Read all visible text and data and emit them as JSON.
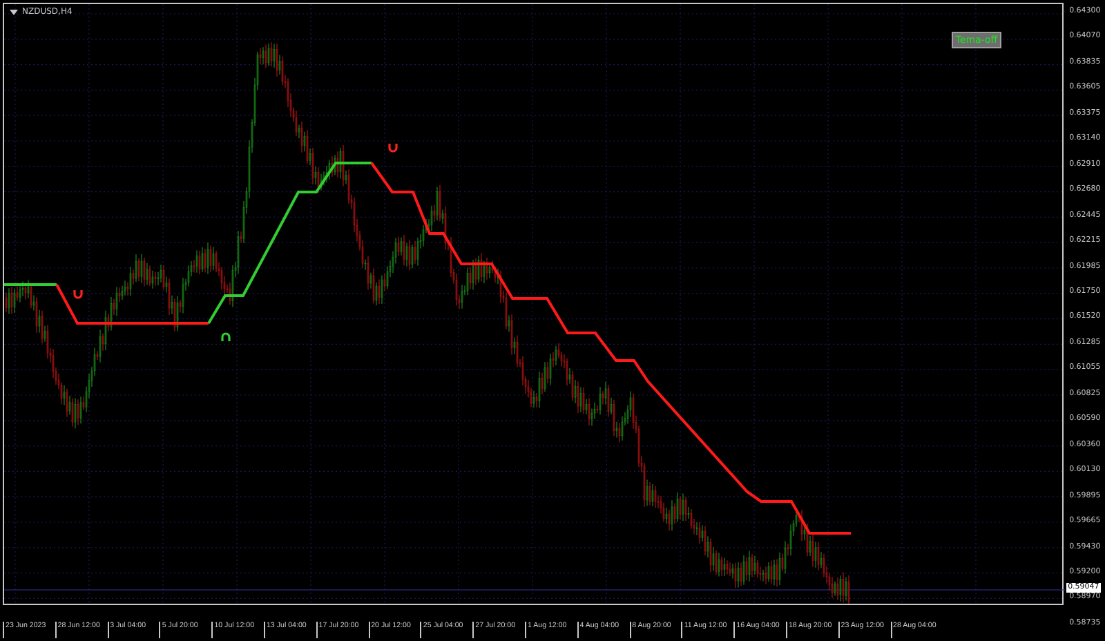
{
  "chart": {
    "symbol": "NZDUSD,H4"
  },
  "toggle_button": {
    "label": "Tema-off"
  },
  "price_axis": [
    "0.64300",
    "0.64070",
    "0.63835",
    "0.63605",
    "0.63375",
    "0.63140",
    "0.62910",
    "0.62680",
    "0.62445",
    "0.62215",
    "0.61985",
    "0.61750",
    "0.61520",
    "0.61285",
    "0.61055",
    "0.60825",
    "0.60590",
    "0.60360",
    "0.60130",
    "0.59895",
    "0.59665",
    "0.59430",
    "0.59200",
    "0.58970",
    "0.58735"
  ],
  "current_price": "0.59047",
  "time_axis": [
    "23 Jun 2023",
    "28 Jun 12:00",
    "3 Jul 04:00",
    "5 Jul 20:00",
    "10 Jul 12:00",
    "13 Jul 04:00",
    "17 Jul 20:00",
    "20 Jul 12:00",
    "25 Jul 04:00",
    "27 Jul 20:00",
    "1 Aug 12:00",
    "4 Aug 04:00",
    "8 Aug 20:00",
    "11 Aug 12:00",
    "16 Aug 04:00",
    "18 Aug 20:00",
    "23 Aug 12:00",
    "28 Aug 04:00"
  ]
}
